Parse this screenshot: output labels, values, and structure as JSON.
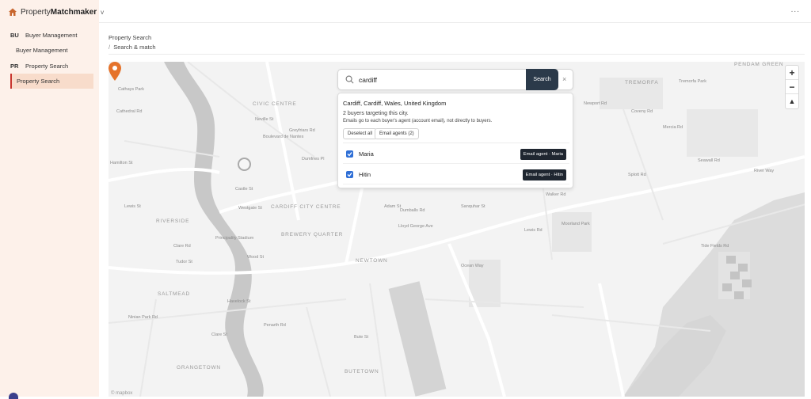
{
  "app": {
    "brand_prefix": "Property",
    "brand_bold": "Matchmaker",
    "brand_chevron": "v",
    "more_menu": "..."
  },
  "sidebar": {
    "groups": [
      {
        "code": "BU",
        "label": "Buyer Management",
        "sub": "Buyer Management"
      },
      {
        "code": "PR",
        "label": "Property Search",
        "sub": "Property Search"
      }
    ]
  },
  "breadcrumb": {
    "title": "Property Search",
    "separator": "/",
    "current": "Search & match"
  },
  "search": {
    "value": "cardiff",
    "button_label": "Search",
    "clear_label": "×"
  },
  "results": {
    "place": "Cardiff, Cardiff, Wales, United Kingdom",
    "count_text": "2 buyers targeting this city.",
    "note": "Emails go to each buyer's agent (account email), not directly to buyers.",
    "deselect_label": "Deselect all",
    "email_agents_label": "Email agents (2)",
    "buyers": [
      {
        "name": "Maria",
        "checked": true,
        "button": "Email agent · Maria"
      },
      {
        "name": "Hitin",
        "checked": true,
        "button": "Email agent · Hitin"
      }
    ]
  },
  "map": {
    "zoom_in": "+",
    "zoom_out": "−",
    "compass": "▲",
    "attribution": "© mapbox",
    "labels": [
      "CIVIC CENTRE",
      "CARDIFF CITY CENTRE",
      "RIVERSIDE",
      "BREWERY QUARTER",
      "NEWTOWN",
      "BUTETOWN",
      "GRANGETOWN",
      "SALTMEAD",
      "TREMORFA",
      "PENDAM GREEN",
      "Cathays Park",
      "Boulevard de Nantes",
      "Greyfriars Rd",
      "Castle St",
      "Westgate St",
      "Wood St",
      "Principality Stadium",
      "Tudor St",
      "Sanquhar St",
      "Walker Rd",
      "Adam St",
      "Dumballs Rd",
      "Ocean Way",
      "Lewis Rd",
      "Seawall Rd",
      "River Way",
      "Tide Fields Rd",
      "Penarth Rd",
      "Lloyd George Ave",
      "Splott Rd",
      "Bute St",
      "Clare Rd",
      "Ninian Park Rd",
      "Moorland Park",
      "Tremorfa Park",
      "Cathedral Rd",
      "Newport Rd",
      "Hamilton St",
      "Lewis St",
      "Coveny Rd",
      "Mercia Rd",
      "Neville St",
      "Clare St",
      "Havelock St",
      "Dumfries Pl"
    ]
  },
  "colors": {
    "sidebar_bg": "#fdf1ea",
    "active_item_bg": "#f8dccb",
    "active_accent": "#c8352e",
    "search_button": "#2b3a4a",
    "agent_button": "#1f2630",
    "checkbox": "#2f6fd6",
    "marker": "#e5732b"
  },
  "icons": {
    "logo": "house-icon",
    "search": "magnifier-icon",
    "marker": "map-pin-icon",
    "check": "checkmark-icon"
  }
}
